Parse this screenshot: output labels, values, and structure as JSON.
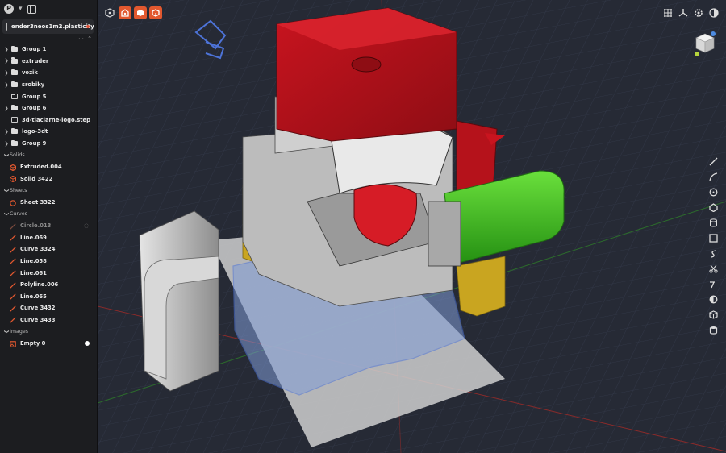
{
  "file": {
    "name": "ender3neos1m2.plasticity",
    "modified": true,
    "avatar_letter": "P"
  },
  "outliner": {
    "groups": [
      {
        "label": "Group 1",
        "expandable": true,
        "outline": false
      },
      {
        "label": "extruder",
        "expandable": true,
        "outline": false
      },
      {
        "label": "vozik",
        "expandable": true,
        "outline": false
      },
      {
        "label": "srobiky",
        "expandable": true,
        "outline": false
      },
      {
        "label": "Group 5",
        "expandable": false,
        "outline": true
      },
      {
        "label": "Group 6",
        "expandable": true,
        "outline": false
      },
      {
        "label": "3d-tlaciarne-logo.step",
        "expandable": false,
        "outline": true
      },
      {
        "label": "logo-3dt",
        "expandable": true,
        "outline": false
      },
      {
        "label": "Group 9",
        "expandable": true,
        "outline": false
      }
    ],
    "sections": {
      "solids": "Solids",
      "sheets": "Sheets",
      "curves": "Curves",
      "images": "Images"
    },
    "solids": [
      {
        "label": "Extruded.004"
      },
      {
        "label": "Solid 3422"
      }
    ],
    "sheets": [
      {
        "label": "Sheet 3322"
      }
    ],
    "curves": [
      {
        "label": "Circle.013",
        "hidden": true
      },
      {
        "label": "Line.069"
      },
      {
        "label": "Curve 3324"
      },
      {
        "label": "Line.058"
      },
      {
        "label": "Line.061"
      },
      {
        "label": "Polyline.006"
      },
      {
        "label": "Line.065"
      },
      {
        "label": "Curve 3432"
      },
      {
        "label": "Curve 3433"
      }
    ],
    "images": [
      {
        "label": "Empty 0"
      }
    ]
  },
  "colors": {
    "accent": "#e2582f",
    "viewport_bg": "#262a35",
    "red_solid": "#b5121b",
    "green_solid": "#3cc21f",
    "yellow_solid": "#c9a520",
    "selection_blue": "#5b7fd9"
  },
  "toolbar_left_icons": [
    "view-mode-icon",
    "solid-mode-icon",
    "face-mode-icon",
    "edge-mode-icon"
  ],
  "toolbar_right_icons": [
    "grid-icon",
    "axes-icon",
    "gear-settings-icon",
    "render-mode-icon"
  ],
  "right_tools": [
    "line-icon",
    "curve-icon",
    "circle-icon",
    "polygon-icon",
    "cylinder-icon",
    "rectangle-icon",
    "spiral-icon",
    "scissors-icon",
    "fillet-icon",
    "shell-icon",
    "box-icon",
    "database-icon"
  ]
}
